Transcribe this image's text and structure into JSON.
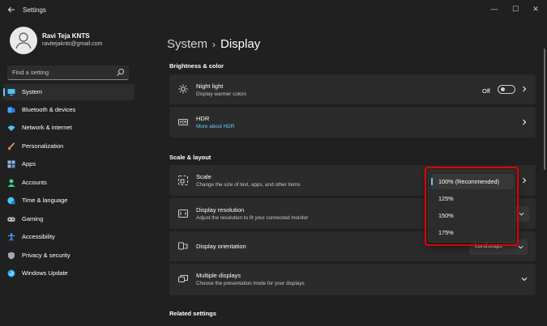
{
  "window": {
    "title": "Settings",
    "controls": [
      "—",
      "☐",
      "✕"
    ]
  },
  "user": {
    "name": "Ravi Teja KNTS",
    "email": "ravitejaknts@gmail.com"
  },
  "search": {
    "placeholder": "Find a setting"
  },
  "sidebar": {
    "items": [
      {
        "label": "System",
        "icon": "monitor-icon",
        "active": true,
        "color": "#4cc2ff"
      },
      {
        "label": "Bluetooth & devices",
        "icon": "bluetooth-icon",
        "color": "#4aa0ff"
      },
      {
        "label": "Network & internet",
        "icon": "wifi-icon",
        "color": "#4cc2ff"
      },
      {
        "label": "Personalization",
        "icon": "brush-icon",
        "color": "#f2a461"
      },
      {
        "label": "Apps",
        "icon": "apps-icon",
        "color": "#8fb8e8"
      },
      {
        "label": "Accounts",
        "icon": "person-icon",
        "color": "#3dd68c"
      },
      {
        "label": "Time & language",
        "icon": "globe-clock-icon",
        "color": "#4cc2ff"
      },
      {
        "label": "Gaming",
        "icon": "controller-icon",
        "color": "#b8b8b8"
      },
      {
        "label": "Accessibility",
        "icon": "accessibility-icon",
        "color": "#4aa0ff"
      },
      {
        "label": "Privacy & security",
        "icon": "shield-icon",
        "color": "#a0a8b4"
      },
      {
        "label": "Windows Update",
        "icon": "update-icon",
        "color": "#2fa8ff"
      }
    ]
  },
  "breadcrumb": {
    "parent": "System",
    "separator": "›",
    "current": "Display"
  },
  "sections": {
    "brightness": "Brightness & color",
    "scale_layout": "Scale & layout",
    "related": "Related settings"
  },
  "cards": {
    "night_light": {
      "title": "Night light",
      "subtitle": "Display warmer colors",
      "toggle_label": "Off"
    },
    "hdr": {
      "title": "HDR",
      "link": "More about HDR",
      "icon_text": "HDR"
    },
    "scale": {
      "title": "Scale",
      "subtitle": "Change the size of text, apps, and other items"
    },
    "resolution": {
      "title": "Display resolution",
      "subtitle": "Adjust the resolution to fit your connected monitor"
    },
    "orientation": {
      "title": "Display orientation",
      "value": "Landscape"
    },
    "multiple": {
      "title": "Multiple displays",
      "subtitle": "Choose the presentation mode for your displays"
    }
  },
  "scale_dropdown": {
    "options": [
      "100% (Recommended)",
      "125%",
      "150%",
      "175%"
    ],
    "selected": "100% (Recommended)"
  },
  "colors": {
    "accent": "#60cdff",
    "background": "#202020",
    "card": "#2b2b2b",
    "highlight": "#e00000"
  }
}
